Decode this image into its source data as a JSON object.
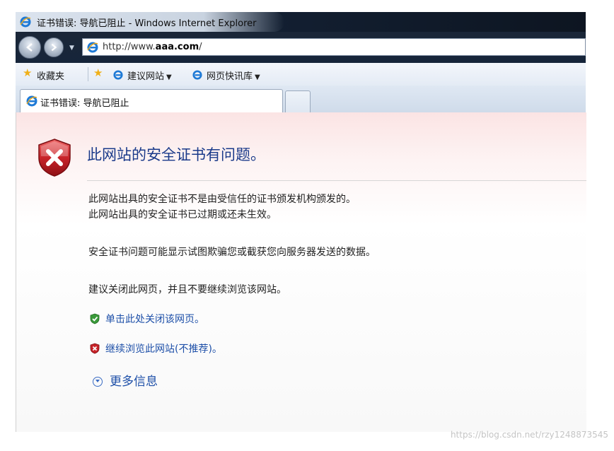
{
  "window": {
    "title": "证书错误: 导航已阻止 - Windows Internet Explorer"
  },
  "address": {
    "url_prefix": "http://www.",
    "url_domain": "aaa.com",
    "url_suffix": "/"
  },
  "favorites_bar": {
    "favorites_label": "收藏夹",
    "suggested_sites": "建议网站",
    "web_slice_gallery": "网页快讯库"
  },
  "tab": {
    "label": "证书错误: 导航已阻止"
  },
  "page": {
    "heading": "此网站的安全证书有问题。",
    "line1": "此网站出具的安全证书不是由受信任的证书颁发机构颁发的。",
    "line2": "此网站出具的安全证书已过期或还未生效。",
    "line3": "安全证书问题可能显示试图欺骗您或截获您向服务器发送的数据。",
    "line4": "建议关闭此网页，并且不要继续浏览该网站。",
    "close_link": "单击此处关闭该网页。",
    "continue_link": "继续浏览此网站(不推荐)。",
    "more_info": "更多信息"
  },
  "watermark": "https://blog.csdn.net/rzy1248873545",
  "colors": {
    "heading": "#1a3a8a",
    "link": "#1d4fa8",
    "shield_red": "#c8242a",
    "safe_green": "#3a9a3a"
  },
  "icons": {
    "shield": "red-shield-x-icon",
    "close_link": "green-shield-check-icon",
    "continue_link": "red-shield-x-icon",
    "more_info": "chevron-circle-down-icon"
  }
}
